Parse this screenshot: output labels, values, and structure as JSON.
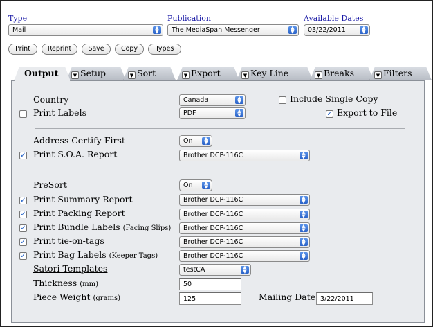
{
  "header": {
    "type_label": "Type",
    "type_value": "Mail",
    "publication_label": "Publication",
    "publication_value": "The MediaSpan Messenger",
    "dates_label": "Available Dates",
    "dates_value": "03/22/2011"
  },
  "toolbar": {
    "print": "Print",
    "reprint": "Reprint",
    "save": "Save",
    "copy": "Copy",
    "types": "Types"
  },
  "tabs": [
    {
      "label": "Output",
      "active": true
    },
    {
      "label": "Setup"
    },
    {
      "label": "Sort"
    },
    {
      "label": "Export"
    },
    {
      "label": "Key Line"
    },
    {
      "label": "Breaks"
    },
    {
      "label": "Filters"
    }
  ],
  "output": {
    "country_label": "Country",
    "country_value": "Canada",
    "include_single_copy_label": "Include Single Copy",
    "print_labels_label": "Print Labels",
    "print_labels_format": "PDF",
    "export_to_file_label": "Export to File",
    "address_certify_label": "Address Certify First",
    "address_certify_value": "On",
    "print_soa_label": "Print S.O.A. Report",
    "print_soa_printer": "Brother DCP-116C",
    "presort_label": "PreSort",
    "presort_value": "On",
    "summary_label": "Print  Summary Report",
    "summary_printer": "Brother DCP-116C",
    "packing_label": "Print Packing Report",
    "packing_printer": "Brother DCP-116C",
    "bundle_label": "Print Bundle Labels",
    "bundle_note": "(Facing Slips)",
    "bundle_printer": "Brother DCP-116C",
    "tieon_label": "Print tie-on-tags",
    "tieon_printer": "Brother DCP-116C",
    "bag_label": "Print Bag Labels",
    "bag_note": "(Keeper Tags)",
    "bag_printer": "Brother DCP-116C",
    "satori_label": "Satori Templates",
    "satori_value": "testCA",
    "thickness_label": "Thickness",
    "thickness_unit": "(mm)",
    "thickness_value": "50",
    "piece_weight_label": "Piece Weight",
    "piece_weight_unit": "(grams)",
    "piece_weight_value": "125",
    "mailing_date_label": "Mailing Date",
    "mailing_date_value": "3/22/2011"
  },
  "icons": {
    "check": "✓",
    "dropdown": "▲▼",
    "tab_toggle": "▼"
  },
  "colors": {
    "label_blue": "#1a1aa6",
    "arrow_blue": "#2a62c8",
    "panel_bg": "#e9ebee"
  }
}
